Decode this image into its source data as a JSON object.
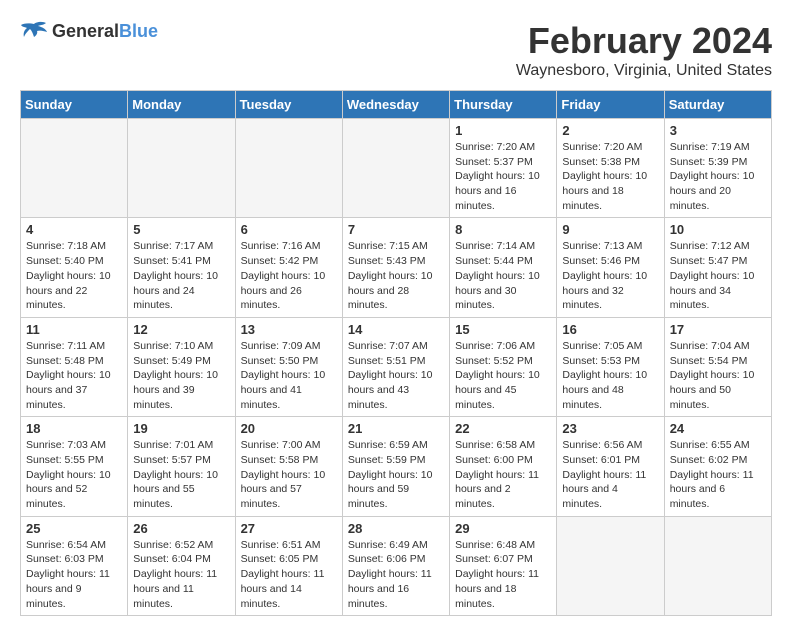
{
  "logo": {
    "text_general": "General",
    "text_blue": "Blue"
  },
  "title": {
    "month_year": "February 2024",
    "location": "Waynesboro, Virginia, United States"
  },
  "headers": [
    "Sunday",
    "Monday",
    "Tuesday",
    "Wednesday",
    "Thursday",
    "Friday",
    "Saturday"
  ],
  "weeks": [
    [
      {
        "day": "",
        "empty": true
      },
      {
        "day": "",
        "empty": true
      },
      {
        "day": "",
        "empty": true
      },
      {
        "day": "",
        "empty": true
      },
      {
        "day": "1",
        "sunrise": "7:20 AM",
        "sunset": "5:37 PM",
        "daylight": "10 hours and 16 minutes."
      },
      {
        "day": "2",
        "sunrise": "7:20 AM",
        "sunset": "5:38 PM",
        "daylight": "10 hours and 18 minutes."
      },
      {
        "day": "3",
        "sunrise": "7:19 AM",
        "sunset": "5:39 PM",
        "daylight": "10 hours and 20 minutes."
      }
    ],
    [
      {
        "day": "4",
        "sunrise": "7:18 AM",
        "sunset": "5:40 PM",
        "daylight": "10 hours and 22 minutes."
      },
      {
        "day": "5",
        "sunrise": "7:17 AM",
        "sunset": "5:41 PM",
        "daylight": "10 hours and 24 minutes."
      },
      {
        "day": "6",
        "sunrise": "7:16 AM",
        "sunset": "5:42 PM",
        "daylight": "10 hours and 26 minutes."
      },
      {
        "day": "7",
        "sunrise": "7:15 AM",
        "sunset": "5:43 PM",
        "daylight": "10 hours and 28 minutes."
      },
      {
        "day": "8",
        "sunrise": "7:14 AM",
        "sunset": "5:44 PM",
        "daylight": "10 hours and 30 minutes."
      },
      {
        "day": "9",
        "sunrise": "7:13 AM",
        "sunset": "5:46 PM",
        "daylight": "10 hours and 32 minutes."
      },
      {
        "day": "10",
        "sunrise": "7:12 AM",
        "sunset": "5:47 PM",
        "daylight": "10 hours and 34 minutes."
      }
    ],
    [
      {
        "day": "11",
        "sunrise": "7:11 AM",
        "sunset": "5:48 PM",
        "daylight": "10 hours and 37 minutes."
      },
      {
        "day": "12",
        "sunrise": "7:10 AM",
        "sunset": "5:49 PM",
        "daylight": "10 hours and 39 minutes."
      },
      {
        "day": "13",
        "sunrise": "7:09 AM",
        "sunset": "5:50 PM",
        "daylight": "10 hours and 41 minutes."
      },
      {
        "day": "14",
        "sunrise": "7:07 AM",
        "sunset": "5:51 PM",
        "daylight": "10 hours and 43 minutes."
      },
      {
        "day": "15",
        "sunrise": "7:06 AM",
        "sunset": "5:52 PM",
        "daylight": "10 hours and 45 minutes."
      },
      {
        "day": "16",
        "sunrise": "7:05 AM",
        "sunset": "5:53 PM",
        "daylight": "10 hours and 48 minutes."
      },
      {
        "day": "17",
        "sunrise": "7:04 AM",
        "sunset": "5:54 PM",
        "daylight": "10 hours and 50 minutes."
      }
    ],
    [
      {
        "day": "18",
        "sunrise": "7:03 AM",
        "sunset": "5:55 PM",
        "daylight": "10 hours and 52 minutes."
      },
      {
        "day": "19",
        "sunrise": "7:01 AM",
        "sunset": "5:57 PM",
        "daylight": "10 hours and 55 minutes."
      },
      {
        "day": "20",
        "sunrise": "7:00 AM",
        "sunset": "5:58 PM",
        "daylight": "10 hours and 57 minutes."
      },
      {
        "day": "21",
        "sunrise": "6:59 AM",
        "sunset": "5:59 PM",
        "daylight": "10 hours and 59 minutes."
      },
      {
        "day": "22",
        "sunrise": "6:58 AM",
        "sunset": "6:00 PM",
        "daylight": "11 hours and 2 minutes."
      },
      {
        "day": "23",
        "sunrise": "6:56 AM",
        "sunset": "6:01 PM",
        "daylight": "11 hours and 4 minutes."
      },
      {
        "day": "24",
        "sunrise": "6:55 AM",
        "sunset": "6:02 PM",
        "daylight": "11 hours and 6 minutes."
      }
    ],
    [
      {
        "day": "25",
        "sunrise": "6:54 AM",
        "sunset": "6:03 PM",
        "daylight": "11 hours and 9 minutes."
      },
      {
        "day": "26",
        "sunrise": "6:52 AM",
        "sunset": "6:04 PM",
        "daylight": "11 hours and 11 minutes."
      },
      {
        "day": "27",
        "sunrise": "6:51 AM",
        "sunset": "6:05 PM",
        "daylight": "11 hours and 14 minutes."
      },
      {
        "day": "28",
        "sunrise": "6:49 AM",
        "sunset": "6:06 PM",
        "daylight": "11 hours and 16 minutes."
      },
      {
        "day": "29",
        "sunrise": "6:48 AM",
        "sunset": "6:07 PM",
        "daylight": "11 hours and 18 minutes."
      },
      {
        "day": "",
        "empty": true
      },
      {
        "day": "",
        "empty": true
      }
    ]
  ],
  "daylight_label": "Daylight hours"
}
